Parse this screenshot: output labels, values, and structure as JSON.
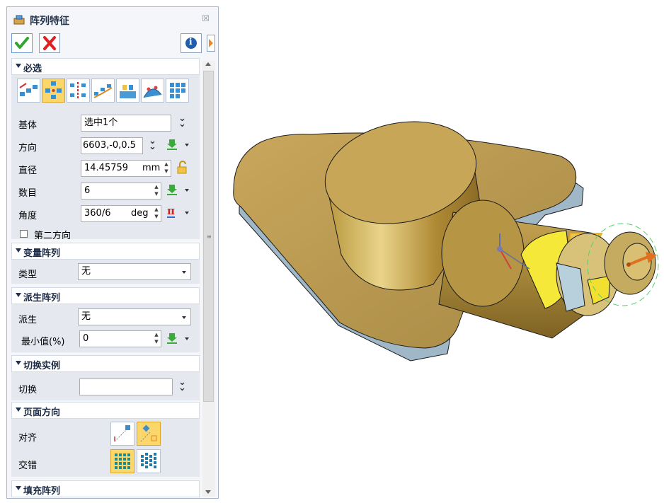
{
  "dialog": {
    "title": "阵列特征",
    "close_glyph": "☒",
    "info_glyph": "i"
  },
  "sections": {
    "required": {
      "title": "必选"
    },
    "variable": {
      "title": "变量阵列"
    },
    "derived": {
      "title": "派生阵列"
    },
    "toggle": {
      "title": "切换实例"
    },
    "page_dir": {
      "title": "页面方向"
    },
    "fill": {
      "title": "填充阵列"
    }
  },
  "required": {
    "base_label": "基体",
    "base_value": "选中1个",
    "direction_label": "方向",
    "direction_value": "6603,-0,0.5",
    "diameter_label": "直径",
    "diameter_value": "14.45759",
    "diameter_unit": "mm",
    "count_label": "数目",
    "count_value": "6",
    "angle_label": "角度",
    "angle_value": "360/6",
    "angle_unit": "deg",
    "second_dir_label": "第二方向",
    "pi_glyph": "π"
  },
  "variable": {
    "type_label": "类型",
    "type_value": "无"
  },
  "derived": {
    "derive_label": "派生",
    "derive_value": "无",
    "min_label": "最小值(%)",
    "min_value": "0"
  },
  "toggle": {
    "toggle_label": "切换",
    "toggle_value": ""
  },
  "page_dir": {
    "align_label": "对齐",
    "stagger_label": "交错"
  },
  "colors": {
    "accent_yellow": "#fbd66a",
    "ok_green": "#2ea62e",
    "cancel_red": "#e02020",
    "model_gold": "#c9a75c"
  }
}
